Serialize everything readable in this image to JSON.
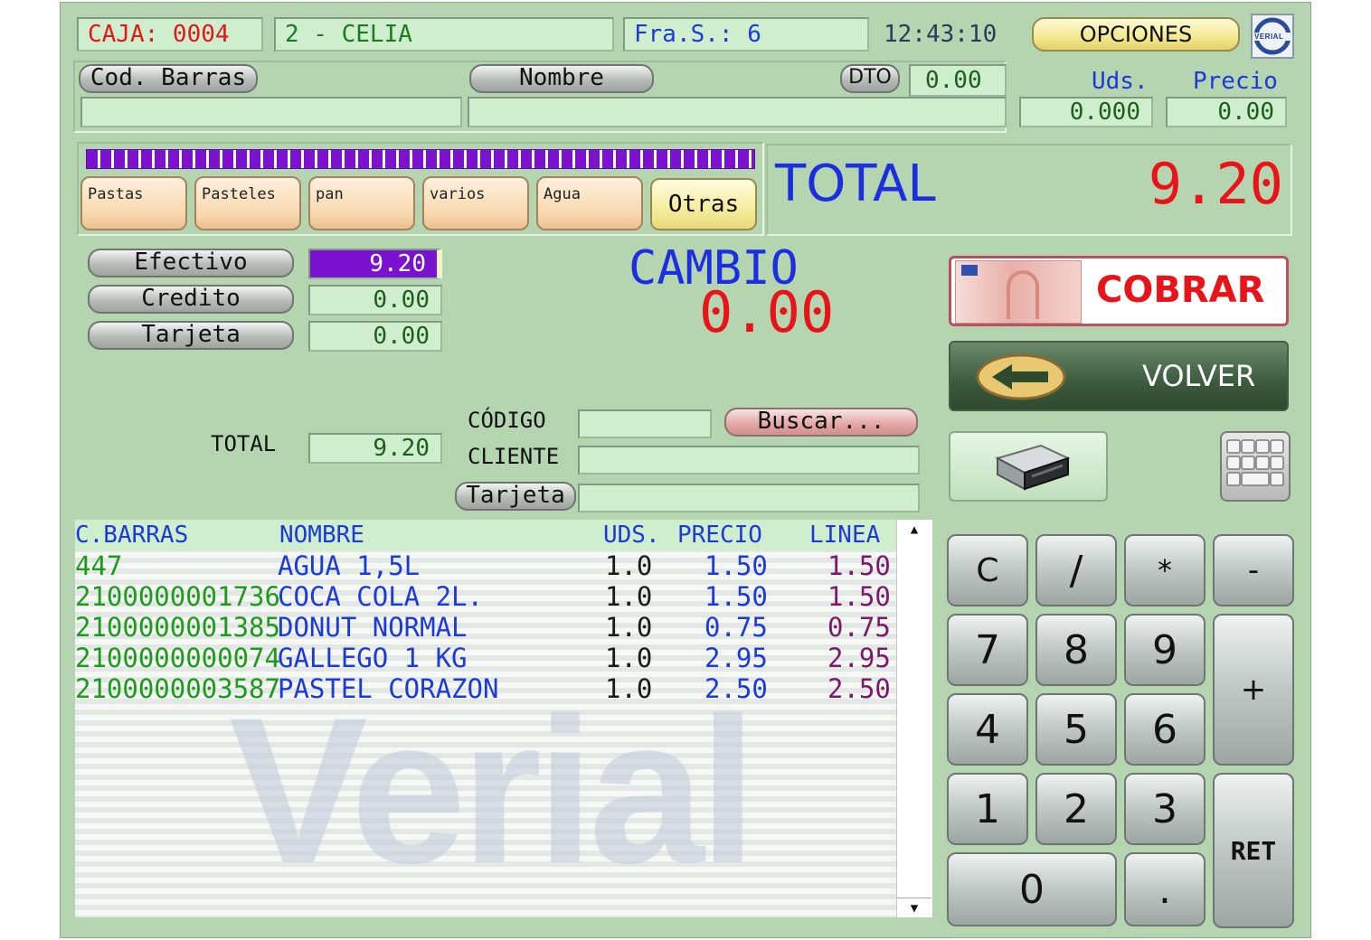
{
  "header": {
    "caja": "CAJA: 0004",
    "vendedor": "2 - CELIA",
    "factura": "Fra.S.: 6",
    "hora": "12:43:10",
    "opciones_label": "OPCIONES",
    "logo_text": "VERIAL"
  },
  "entry": {
    "cod_barras_label": "Cod. Barras",
    "nombre_label": "Nombre",
    "dto_label": "DTO",
    "dto_value": "0.00",
    "uds_label": "Uds.",
    "uds_value": "0.000",
    "precio_label": "Precio",
    "precio_value": "0.00"
  },
  "categories": [
    "Pastas",
    "Pasteles",
    "pan",
    "varios",
    "Agua"
  ],
  "otras_label": "Otras",
  "total_panel": {
    "label": "TOTAL",
    "value": "9.20"
  },
  "payment": {
    "efectivo_label": "Efectivo",
    "efectivo_value": "9.20",
    "credito_label": "Credito",
    "credito_value": "0.00",
    "tarjeta_label": "Tarjeta",
    "tarjeta_value": "0.00"
  },
  "cambio": {
    "label": "CAMBIO",
    "value": "0.00"
  },
  "cobrar_label": "COBRAR",
  "volver_label": "VOLVER",
  "customer": {
    "total_label": "TOTAL",
    "total_value": "9.20",
    "codigo_label": "CÓDIGO",
    "buscar_label": "Buscar...",
    "cliente_label": "CLIENTE",
    "tarjeta_label": "Tarjeta"
  },
  "lines_table": {
    "columns": [
      "C.BARRAS",
      "NOMBRE",
      "UDS.",
      "PRECIO",
      "LINEA"
    ],
    "rows": [
      [
        "447",
        "AGUA 1,5L",
        "1.0",
        "1.50",
        "1.50"
      ],
      [
        "2100000001736",
        "COCA COLA 2L.",
        "1.0",
        "1.50",
        "1.50"
      ],
      [
        "2100000001385",
        "DONUT NORMAL",
        "1.0",
        "0.75",
        "0.75"
      ],
      [
        "2100000000074",
        "GALLEGO 1 KG",
        "1.0",
        "2.95",
        "2.95"
      ],
      [
        "2100000003587",
        "PASTEL CORAZON",
        "1.0",
        "2.50",
        "2.50"
      ]
    ],
    "watermark": "Verial"
  },
  "keypad": {
    "c": "C",
    "div": "/",
    "mul": "*",
    "minus": "-",
    "k7": "7",
    "k8": "8",
    "k9": "9",
    "plus": "+",
    "k4": "4",
    "k5": "5",
    "k6": "6",
    "k1": "1",
    "k2": "2",
    "k3": "3",
    "ret": "RET",
    "k0": "0",
    "dot": "."
  },
  "colors": {
    "background": "#b5d4b0",
    "field": "#cfeecd",
    "red": "#e8141a",
    "blue": "#1b2ee0",
    "progress": "#7b12d0"
  }
}
